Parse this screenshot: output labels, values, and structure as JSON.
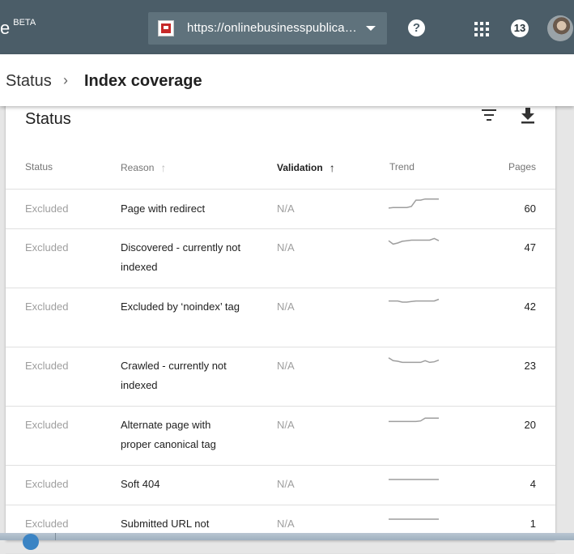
{
  "header": {
    "brand_fragment": "e",
    "brand_badge": "BETA",
    "property_url": "https://onlinebusinesspublica…",
    "notification_count": "13"
  },
  "breadcrumb": {
    "parent": "Status",
    "separator": "›",
    "current": "Index coverage"
  },
  "card": {
    "title": "Status"
  },
  "table": {
    "columns": [
      "Status",
      "Reason",
      "Validation",
      "Trend",
      "Pages"
    ],
    "sorted_column": "Validation",
    "rows": [
      {
        "status": "Excluded",
        "reason": "Page with redirect",
        "validation": "N/A",
        "pages": "60",
        "trend": [
          0.15,
          0.2,
          0.2,
          0.2,
          0.2,
          0.3,
          0.85,
          0.85,
          0.95,
          0.95,
          0.95,
          0.95
        ]
      },
      {
        "status": "Excluded",
        "reason": "Discovered - currently not indexed",
        "validation": "N/A",
        "pages": "47",
        "trend": [
          0.7,
          0.4,
          0.5,
          0.65,
          0.7,
          0.75,
          0.75,
          0.75,
          0.75,
          0.75,
          0.9,
          0.7
        ]
      },
      {
        "status": "Excluded",
        "reason": "Excluded by ‘noindex’ tag",
        "validation": "N/A",
        "pages": "42",
        "trend": [
          0.6,
          0.6,
          0.6,
          0.5,
          0.5,
          0.55,
          0.6,
          0.6,
          0.6,
          0.6,
          0.6,
          0.75
        ]
      },
      {
        "status": "Excluded",
        "reason": "Crawled - currently not indexed",
        "validation": "N/A",
        "pages": "23",
        "trend": [
          0.8,
          0.55,
          0.5,
          0.4,
          0.4,
          0.4,
          0.4,
          0.4,
          0.55,
          0.4,
          0.45,
          0.6
        ]
      },
      {
        "status": "Excluded",
        "reason": "Alternate page with proper canonical tag",
        "validation": "N/A",
        "pages": "20",
        "trend": [
          0.4,
          0.4,
          0.4,
          0.4,
          0.4,
          0.4,
          0.4,
          0.45,
          0.7,
          0.7,
          0.7,
          0.7
        ]
      },
      {
        "status": "Excluded",
        "reason": "Soft 404",
        "validation": "N/A",
        "pages": "4",
        "trend": [
          0.5,
          0.5,
          0.5,
          0.5,
          0.5,
          0.5,
          0.5,
          0.5,
          0.5,
          0.5,
          0.5,
          0.5
        ]
      },
      {
        "status": "Excluded",
        "reason": "Submitted URL not",
        "validation": "N/A",
        "pages": "1",
        "trend": [
          0.5,
          0.5,
          0.5,
          0.5,
          0.5,
          0.5,
          0.5,
          0.5,
          0.5,
          0.5,
          0.5,
          0.5
        ]
      }
    ]
  },
  "colors": {
    "header_bg": "#4b5d68",
    "property_selector_bg": "#5f727c",
    "trend_line": "#9e9e9e"
  }
}
